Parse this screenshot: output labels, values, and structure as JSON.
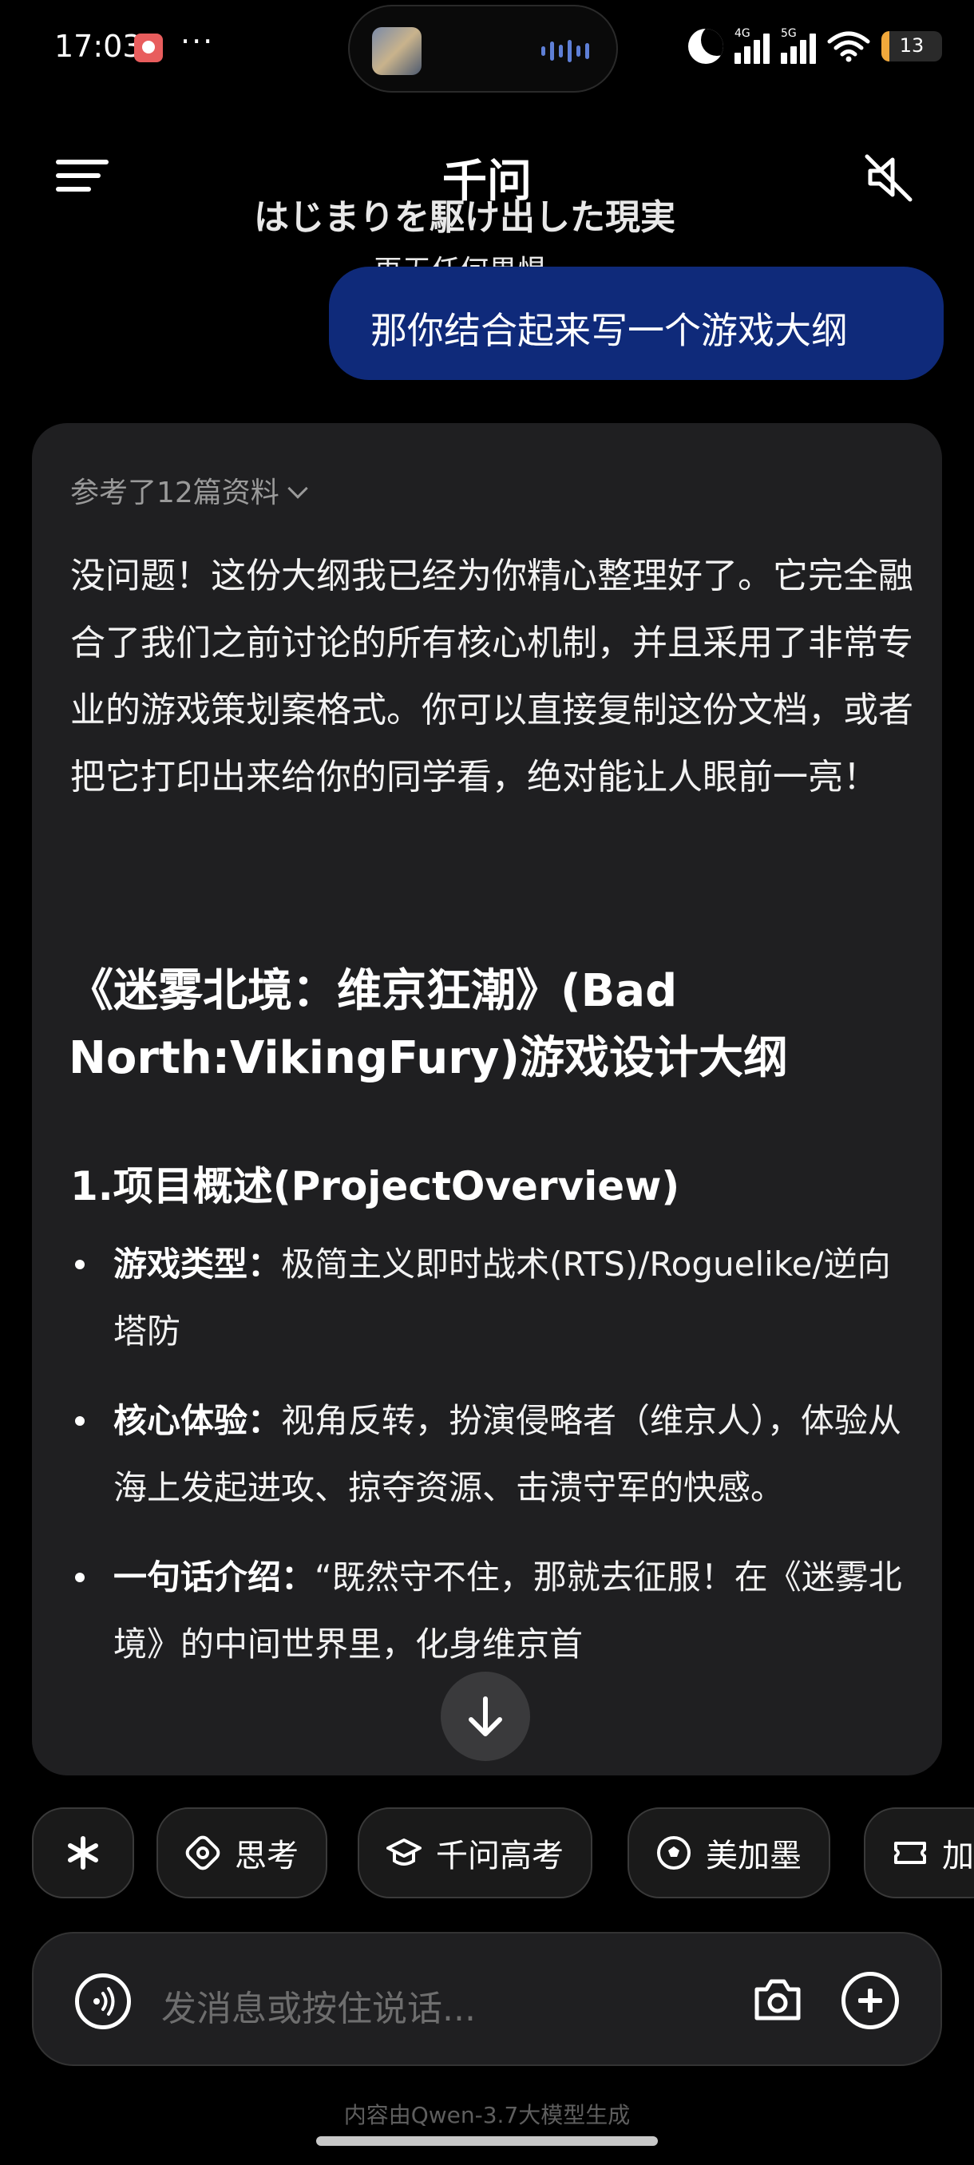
{
  "status_bar": {
    "time": "17:03",
    "dots": "···",
    "signal1_label": "4G",
    "signal2_label": "5G",
    "battery_text": "13",
    "battery_level_percent": 13,
    "battery_color": "#f2a93b"
  },
  "header": {
    "title": "千问",
    "lyrics_line1": "はじまりを駆け出した現実",
    "lyrics_line2": "再无任何畏惧"
  },
  "user_message": "那你结合起来写一个游戏大纲",
  "answer": {
    "references": "参考了12篇资料",
    "intro": "没问题！这份大纲我已经为你精心整理好了。它完全融合了我们之前讨论的所有核心机制，并且采用了非常专业的游戏策划案格式。你可以直接复制这份文档，或者把它打印出来给你的同学看，绝对能让人眼前一亮！",
    "doc_title": "《迷雾北境：维京狂潮》(Bad North:VikingFury)游戏设计大纲",
    "section_title": "1.项目概述(ProjectOverview)",
    "bullets": [
      {
        "label": "游戏类型：",
        "text": "极简主义即时战术(RTS)/Roguelike/逆向塔防"
      },
      {
        "label": "核心体验：",
        "text": "视角反转，扮演侵略者（维京人），体验从海上发起进攻、掠夺资源、击溃守军的快感。"
      },
      {
        "label": "一句话介绍：",
        "text": "“既然守不住，那就去征服！在《迷雾北境》的中间世界里，化身维京首"
      }
    ]
  },
  "chips": [
    {
      "icon": "sparkle-icon",
      "label": ""
    },
    {
      "icon": "think-icon",
      "label": "思考"
    },
    {
      "icon": "graduation-cap-icon",
      "label": "千问高考"
    },
    {
      "icon": "soccer-ball-icon",
      "label": "美加墨"
    },
    {
      "icon": "ticket-icon",
      "label": "加"
    }
  ],
  "input": {
    "placeholder": "发消息或按住说话..."
  },
  "disclaimer": "内容由Qwen-3.7大模型生成",
  "colors": {
    "background": "#000000",
    "card": "#1f1f21",
    "user_bubble": "#0f2a7a",
    "accent": "#5e7fd6"
  }
}
